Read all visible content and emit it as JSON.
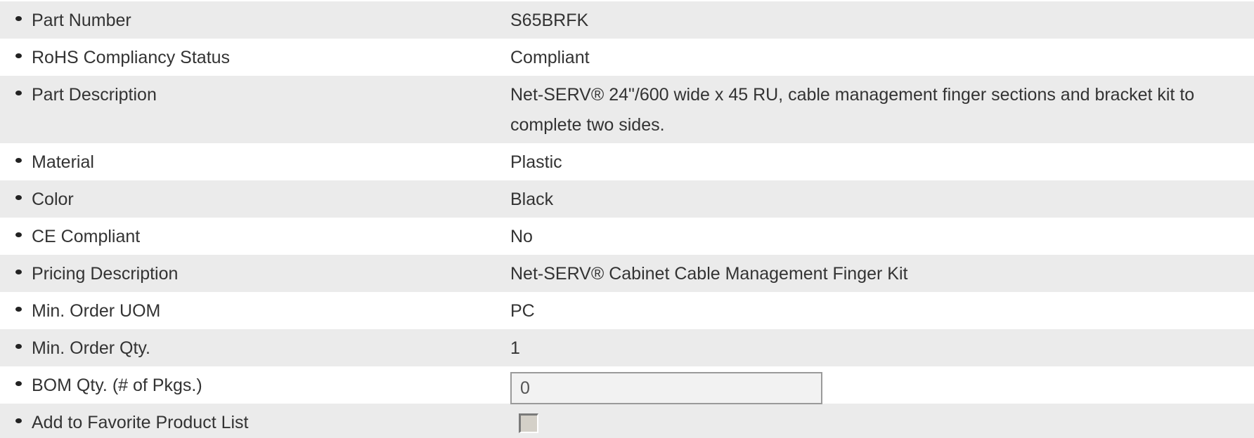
{
  "specs": {
    "part_number": {
      "label": "Part Number",
      "value": "S65BRFK"
    },
    "rohs": {
      "label": "RoHS Compliancy Status",
      "value": "Compliant"
    },
    "part_description": {
      "label": "Part Description",
      "value": "Net-SERV® 24\"/600 wide x 45 RU, cable management finger sections and bracket kit to complete two sides."
    },
    "material": {
      "label": "Material",
      "value": "Plastic"
    },
    "color": {
      "label": "Color",
      "value": "Black"
    },
    "ce_compliant": {
      "label": "CE Compliant",
      "value": "No"
    },
    "pricing_description": {
      "label": "Pricing Description",
      "value": "Net-SERV® Cabinet Cable Management Finger Kit"
    },
    "min_order_uom": {
      "label": "Min. Order UOM",
      "value": "PC"
    },
    "min_order_qty": {
      "label": "Min. Order Qty.",
      "value": "1"
    },
    "bom_qty": {
      "label": "BOM Qty. (# of Pkgs.)",
      "value": "0"
    },
    "favorite": {
      "label": "Add to Favorite Product List",
      "checked": false
    }
  }
}
